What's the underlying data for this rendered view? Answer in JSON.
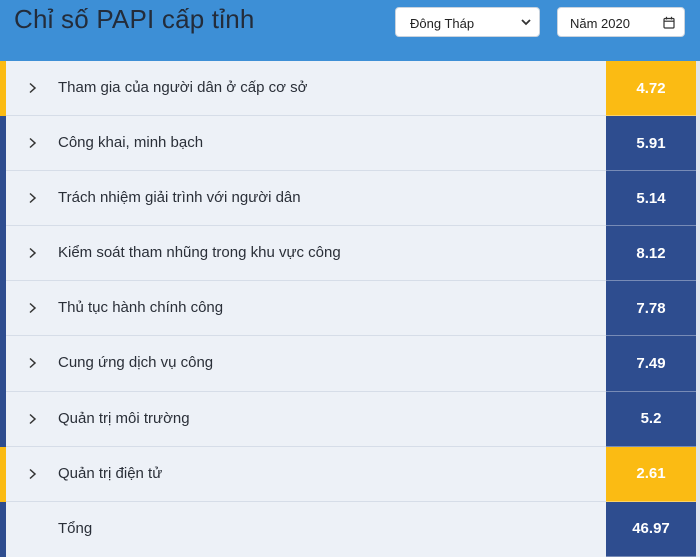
{
  "header": {
    "title": "Chỉ số PAPI cấp tỉnh",
    "province": "Đông Tháp",
    "year": "Năm 2020"
  },
  "colors": {
    "header_bg": "#3d8fd6",
    "high": "#2e4d8f",
    "low": "#fbbb13",
    "row_bg": "#edf1f7"
  },
  "rows": [
    {
      "label": "Tham gia của người dân ở cấp cơ sở",
      "score": "4.72",
      "status": "low"
    },
    {
      "label": "Công khai, minh bạch",
      "score": "5.91",
      "status": "high"
    },
    {
      "label": "Trách nhiệm giải trình với người dân",
      "score": "5.14",
      "status": "high"
    },
    {
      "label": "Kiểm soát tham nhũng trong khu vực công",
      "score": "8.12",
      "status": "high"
    },
    {
      "label": "Thủ tục hành chính công",
      "score": "7.78",
      "status": "high"
    },
    {
      "label": "Cung ứng dịch vụ công",
      "score": "7.49",
      "status": "high"
    },
    {
      "label": "Quản trị môi trường",
      "score": "5.2",
      "status": "high"
    },
    {
      "label": "Quản trị điện tử",
      "score": "2.61",
      "status": "low"
    }
  ],
  "total": {
    "label": "Tổng",
    "score": "46.97",
    "status": "high"
  }
}
